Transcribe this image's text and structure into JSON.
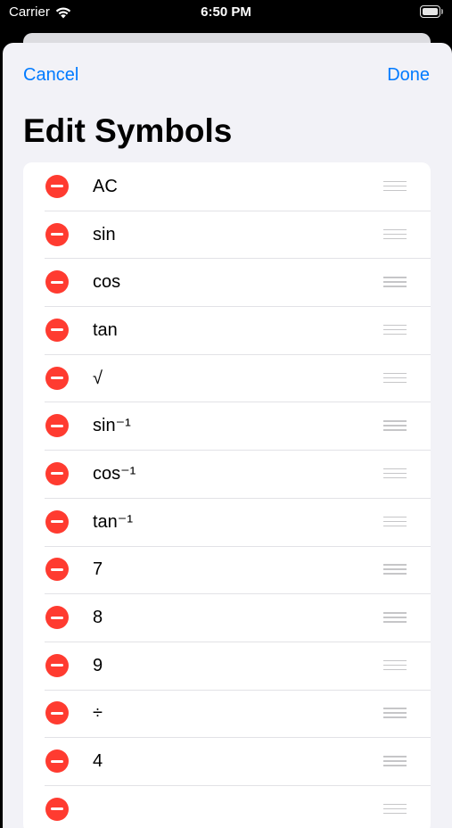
{
  "status_bar": {
    "carrier": "Carrier",
    "time": "6:50 PM",
    "wifi_icon": "wifi-icon",
    "battery_icon": "battery-icon"
  },
  "nav": {
    "cancel_label": "Cancel",
    "done_label": "Done"
  },
  "title": "Edit Symbols",
  "symbols": [
    {
      "label": "AC"
    },
    {
      "label": "sin"
    },
    {
      "label": "cos"
    },
    {
      "label": "tan"
    },
    {
      "label": "√"
    },
    {
      "label": "sin⁻¹"
    },
    {
      "label": "cos⁻¹"
    },
    {
      "label": "tan⁻¹"
    },
    {
      "label": "7"
    },
    {
      "label": "8"
    },
    {
      "label": "9"
    },
    {
      "label": "÷"
    },
    {
      "label": "4"
    },
    {
      "label": ""
    }
  ],
  "colors": {
    "accent": "#007aff",
    "delete": "#ff3b30",
    "sheet_background": "#f2f2f7",
    "row_background": "#ffffff"
  }
}
